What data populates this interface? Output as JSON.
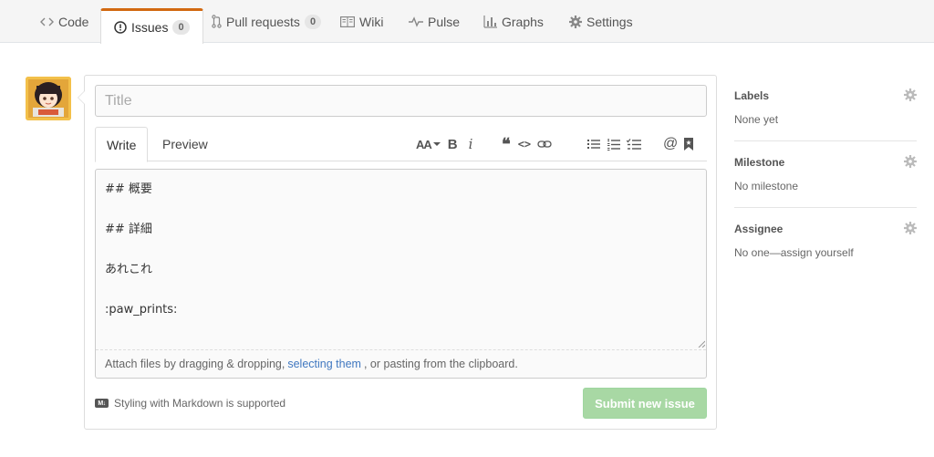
{
  "nav": {
    "tabs": [
      {
        "label": "Code",
        "icon": "code-icon"
      },
      {
        "label": "Issues",
        "icon": "issue-opened-icon",
        "counter": "0",
        "selected": true
      },
      {
        "label": "Pull requests",
        "icon": "git-pull-request-icon",
        "counter": "0"
      },
      {
        "label": "Wiki",
        "icon": "book-icon"
      },
      {
        "label": "Pulse",
        "icon": "pulse-icon"
      },
      {
        "label": "Graphs",
        "icon": "graph-icon"
      },
      {
        "label": "Settings",
        "icon": "gear-icon"
      }
    ]
  },
  "issue": {
    "title_placeholder": "Title",
    "title_value": "",
    "write_tab": "Write",
    "preview_tab": "Preview",
    "body_value": "## 概要\n\n## 詳細\n\nあれこれ\n\n:paw_prints:",
    "toolbar": {
      "header": "AA",
      "bold": "B",
      "italic": "i",
      "quote": "❝",
      "code": "<>",
      "at": "@"
    },
    "attach_text_before": "Attach files by dragging & dropping,",
    "attach_link": "selecting them",
    "attach_text_after": ", or pasting from the clipboard.",
    "markdown_badge": "M↓",
    "markdown_note": "Styling with Markdown is supported",
    "submit_label": "Submit new issue"
  },
  "sidebar": {
    "labels": {
      "heading": "Labels",
      "value": "None yet"
    },
    "milestone": {
      "heading": "Milestone",
      "value": "No milestone"
    },
    "assignee": {
      "heading": "Assignee",
      "value": "No one—assign yourself"
    }
  },
  "colors": {
    "accent_tab": "#d26911",
    "submit_bg": "#a8d8a4",
    "link": "#4078c0"
  }
}
